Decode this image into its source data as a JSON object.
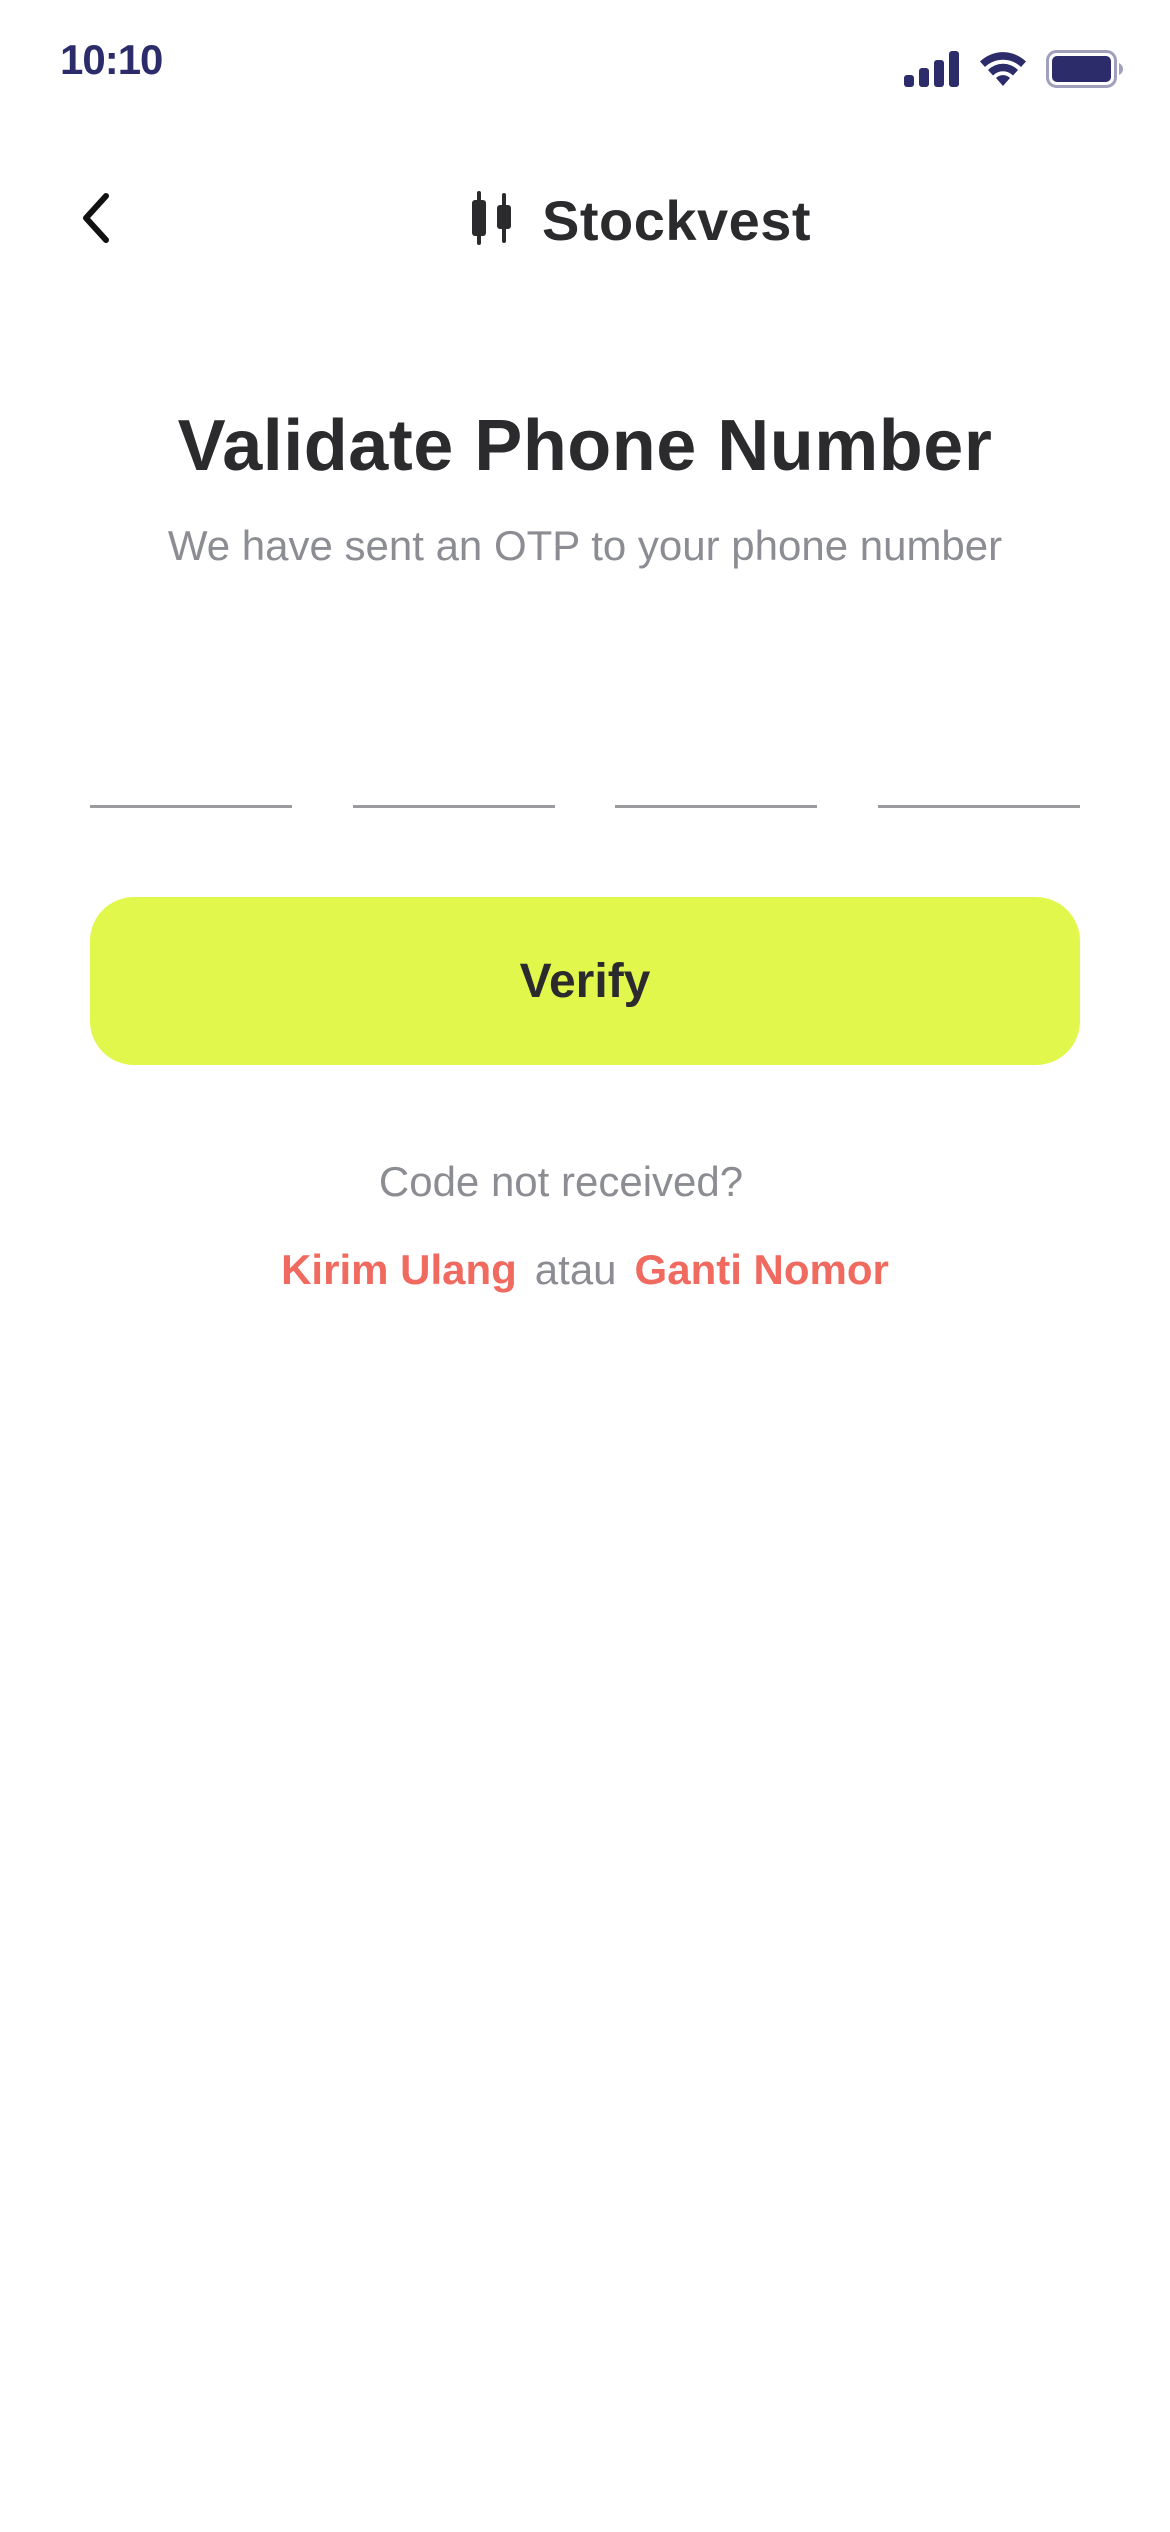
{
  "status_bar": {
    "time": "10:10",
    "icons": [
      "cellular-signal-icon",
      "wifi-icon",
      "battery-icon"
    ]
  },
  "header": {
    "back_icon": "chevron-left-icon",
    "logo_icon": "candlestick-icon",
    "brand_name": "Stockvest"
  },
  "main": {
    "title": "Validate Phone Number",
    "subtitle": "We have sent an OTP to your phone number",
    "otp_fields": [
      {
        "value": ""
      },
      {
        "value": ""
      },
      {
        "value": ""
      },
      {
        "value": ""
      }
    ],
    "verify_label": "Verify",
    "code_not_received": "Code not received?",
    "resend_label": "Kirim Ulang",
    "separator": "atau",
    "change_number_label": "Ganti Nomor"
  },
  "colors": {
    "accent": "#e2f74b",
    "link": "#f06a5f",
    "text_primary": "#2b2b2e",
    "text_secondary": "#8b8d92",
    "status_icons": "#2c2c6a"
  }
}
